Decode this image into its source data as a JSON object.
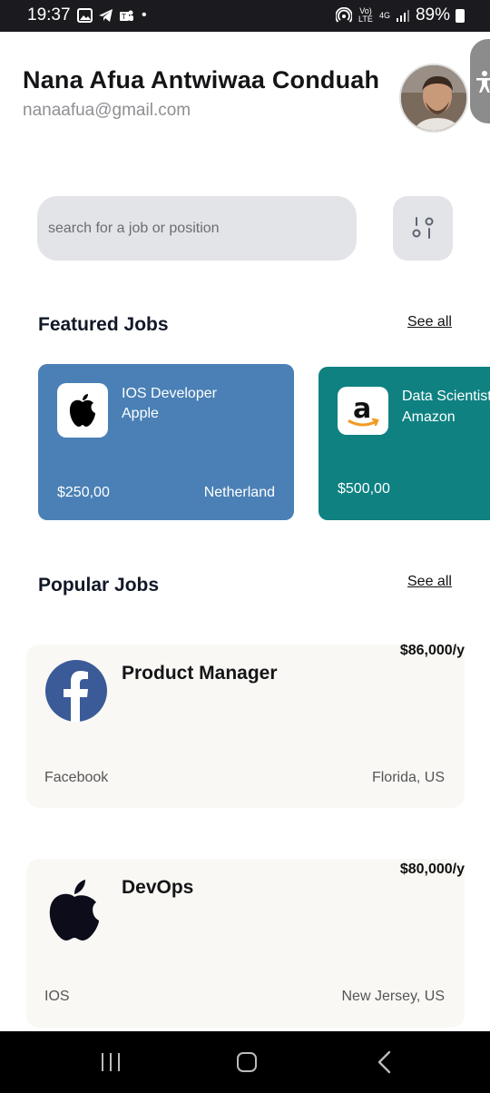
{
  "status_bar": {
    "time": "19:37",
    "dot": "•",
    "volte": "Vo) LTE",
    "network": "4G",
    "battery": "89%",
    "icons": [
      "gallery-icon",
      "telegram-icon",
      "teams-icon",
      "hotspot-icon",
      "signal-icon",
      "battery-icon"
    ]
  },
  "header": {
    "name": "Nana Afua Antwiwaa Conduah",
    "email": "nanaafua@gmail.com"
  },
  "search": {
    "placeholder": "search for a job or position"
  },
  "featured": {
    "title": "Featured Jobs",
    "see_all": "See all",
    "jobs": [
      {
        "title": "IOS Developer",
        "company": "Apple",
        "salary": "$250,00",
        "location": "Netherland",
        "color": "#4a80b5"
      },
      {
        "title": "Data Scientist",
        "company": "Amazon",
        "salary": "$500,00",
        "location": "",
        "color": "#0f8181"
      }
    ]
  },
  "popular": {
    "title": "Popular Jobs",
    "see_all": "See all",
    "jobs": [
      {
        "title": "Product Manager",
        "company": "Facebook",
        "salary": "$86,000/y",
        "location": "Florida, US"
      },
      {
        "title": "DevOps",
        "company": "IOS",
        "salary": "$80,000/y",
        "location": "New Jersey, US"
      }
    ]
  },
  "colors": {
    "accent_blue": "#4a80b5",
    "accent_teal": "#0f8181",
    "facebook_blue": "#3b5a98"
  }
}
